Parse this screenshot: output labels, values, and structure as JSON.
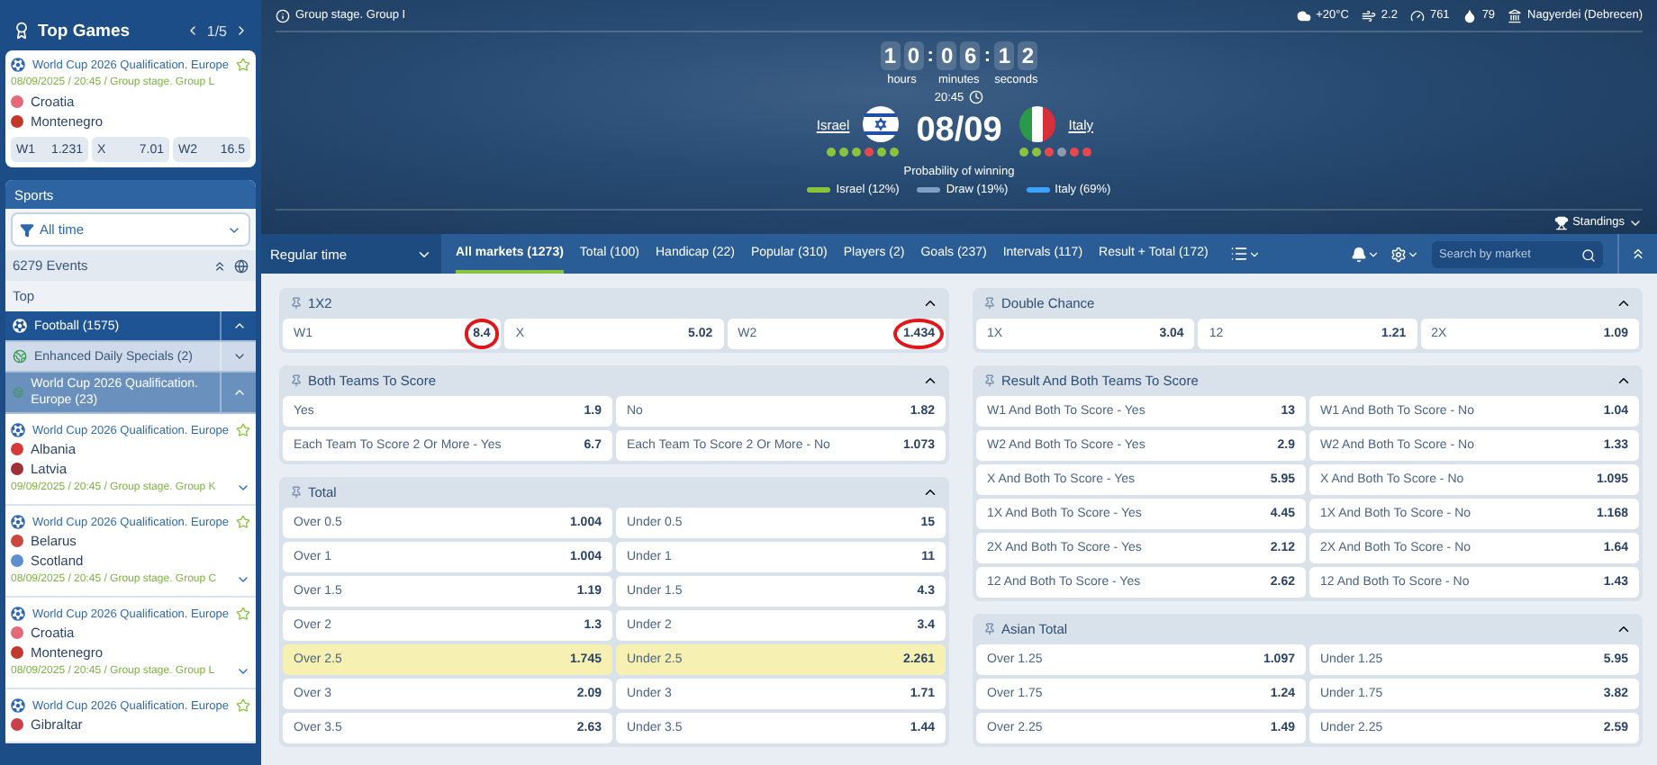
{
  "sidebar": {
    "top_games": {
      "title": "Top Games",
      "pager": "1/5",
      "game": {
        "league": "World Cup 2026 Qualification. Europe",
        "date": "08/09/2025 / 20:45 / Group stage. Group L",
        "teams": [
          {
            "name": "Croatia",
            "color": "#e36a78"
          },
          {
            "name": "Montenegro",
            "color": "#c0392b"
          }
        ],
        "odds": [
          {
            "label": "W1",
            "value": "1.231"
          },
          {
            "label": "X",
            "value": "7.01"
          },
          {
            "label": "W2",
            "value": "16.5"
          }
        ]
      }
    },
    "sports": {
      "title": "Sports",
      "filter": "All time",
      "events": "6279 Events",
      "top": "Top",
      "categories": [
        {
          "name": "Football (1575)",
          "kind": "sport",
          "expanded": true
        },
        {
          "name": "Enhanced Daily Specials (2)",
          "kind": "league",
          "expanded": false
        },
        {
          "name": "World Cup 2026 Qualification. Europe (23)",
          "kind": "league",
          "expanded": true
        }
      ],
      "matches": [
        {
          "league": "World Cup 2026 Qualification. Europe",
          "teams": [
            {
              "name": "Albania",
              "color": "#d33a3a"
            },
            {
              "name": "Latvia",
              "color": "#9e3039"
            }
          ],
          "date": "09/09/2025 / 20:45 / Group stage. Group K"
        },
        {
          "league": "World Cup 2026 Qualification. Europe",
          "teams": [
            {
              "name": "Belarus",
              "color": "#c9473f"
            },
            {
              "name": "Scotland",
              "color": "#5b8fd0"
            }
          ],
          "date": "08/09/2025 / 20:45 / Group stage. Group C"
        },
        {
          "league": "World Cup 2026 Qualification. Europe",
          "teams": [
            {
              "name": "Croatia",
              "color": "#e36a78"
            },
            {
              "name": "Montenegro",
              "color": "#c0392b"
            }
          ],
          "date": "08/09/2025 / 20:45 / Group stage. Group L"
        },
        {
          "league": "World Cup 2026 Qualification. Europe",
          "teams": [
            {
              "name": "Gibraltar",
              "color": "#c8414b"
            }
          ]
        }
      ]
    }
  },
  "match": {
    "stage": "Group stage. Group I",
    "weather": [
      {
        "kind": "temperature",
        "text": "+20°C"
      },
      {
        "kind": "wind",
        "text": "2.2"
      },
      {
        "kind": "pressure",
        "text": "761"
      },
      {
        "kind": "humidity",
        "text": "79"
      },
      {
        "kind": "stadium",
        "text": "Nagyerdei (Debrecen)"
      }
    ],
    "countdown": [
      {
        "digits": [
          "1",
          "0"
        ],
        "unit": "hours",
        "separator": ":"
      },
      {
        "digits": [
          "0",
          "6"
        ],
        "unit": "minutes",
        "separator": ":"
      },
      {
        "digits": [
          "1",
          "2"
        ],
        "unit": "seconds"
      }
    ],
    "time": "20:45",
    "date": "08/09",
    "home": {
      "name": "Israel",
      "form": [
        {
          "color": "#8ac43f"
        },
        {
          "color": "#8ac43f"
        },
        {
          "color": "#8ac43f"
        },
        {
          "color": "#e8474b"
        },
        {
          "color": "#8ac43f"
        },
        {
          "color": "#8ac43f"
        }
      ]
    },
    "away": {
      "name": "Italy",
      "form": [
        {
          "color": "#8ac43f"
        },
        {
          "color": "#8ac43f"
        },
        {
          "color": "#e8474b"
        },
        {
          "color": "#8e9aab"
        },
        {
          "color": "#e8474b"
        },
        {
          "color": "#e8474b"
        }
      ]
    },
    "probability": {
      "title": "Probability of winning",
      "items": [
        {
          "text": "Israel (12%)",
          "color": "#8ac43f"
        },
        {
          "text": "Draw (19%)",
          "color": "#7f9fc4"
        },
        {
          "text": "Italy (69%)",
          "color": "#3ea2ff"
        }
      ]
    },
    "standings": "Standings"
  },
  "markets_bar": {
    "period": "Regular time",
    "tabs": [
      {
        "label": "All markets (1273)",
        "selected": true
      },
      {
        "label": "Total (100)",
        "selected": false
      },
      {
        "label": "Handicap (22)",
        "selected": false
      },
      {
        "label": "Popular (310)",
        "selected": false
      },
      {
        "label": "Players (2)",
        "selected": false
      },
      {
        "label": "Goals (237)",
        "selected": false
      },
      {
        "label": "Intervals (117)",
        "selected": false
      },
      {
        "label": "Result + Total (172)",
        "selected": false
      }
    ],
    "search": {
      "placeholder": "Search by market"
    }
  },
  "markets": [
    [
      {
        "title": "1X2",
        "kind": "three-way",
        "expanded": true,
        "outcomes": [
          {
            "label": "W1",
            "odds": "8.4",
            "highlighted": false,
            "circled": true
          },
          {
            "label": "X",
            "odds": "5.02",
            "highlighted": false,
            "circled": false
          },
          {
            "label": "W2",
            "odds": "1.434",
            "highlighted": false,
            "circled": true
          }
        ]
      },
      {
        "title": "Both Teams To Score",
        "kind": "two-way",
        "expanded": true,
        "outcomes": [
          {
            "label": "Yes",
            "odds": "1.9",
            "highlighted": false
          },
          {
            "label": "No",
            "odds": "1.82",
            "highlighted": false
          },
          {
            "label": "Each Team To Score 2 Or More - Yes",
            "odds": "6.7",
            "highlighted": false
          },
          {
            "label": "Each Team To Score 2 Or More - No",
            "odds": "1.073",
            "highlighted": false
          }
        ]
      },
      {
        "title": "Total",
        "kind": "two-way",
        "expanded": true,
        "outcomes": [
          {
            "label": "Over 0.5",
            "odds": "1.004",
            "highlighted": false
          },
          {
            "label": "Under 0.5",
            "odds": "15",
            "highlighted": false
          },
          {
            "label": "Over 1",
            "odds": "1.004",
            "highlighted": false
          },
          {
            "label": "Under 1",
            "odds": "11",
            "highlighted": false
          },
          {
            "label": "Over 1.5",
            "odds": "1.19",
            "highlighted": false
          },
          {
            "label": "Under 1.5",
            "odds": "4.3",
            "highlighted": false
          },
          {
            "label": "Over 2",
            "odds": "1.3",
            "highlighted": false
          },
          {
            "label": "Under 2",
            "odds": "3.4",
            "highlighted": false
          },
          {
            "label": "Over 2.5",
            "odds": "1.745",
            "highlighted": true
          },
          {
            "label": "Under 2.5",
            "odds": "2.261",
            "highlighted": true
          },
          {
            "label": "Over 3",
            "odds": "2.09",
            "highlighted": false
          },
          {
            "label": "Under 3",
            "odds": "1.71",
            "highlighted": false
          },
          {
            "label": "Over 3.5",
            "odds": "2.63",
            "highlighted": false
          },
          {
            "label": "Under 3.5",
            "odds": "1.44",
            "highlighted": false
          }
        ]
      }
    ],
    [
      {
        "title": "Double Chance",
        "kind": "three-way",
        "expanded": true,
        "outcomes": [
          {
            "label": "1X",
            "odds": "3.04",
            "highlighted": false
          },
          {
            "label": "12",
            "odds": "1.21",
            "highlighted": false
          },
          {
            "label": "2X",
            "odds": "1.09",
            "highlighted": false
          }
        ]
      },
      {
        "title": "Result And Both Teams To Score",
        "kind": "two-way",
        "expanded": true,
        "outcomes": [
          {
            "label": "W1 And Both To Score - Yes",
            "odds": "13",
            "highlighted": false
          },
          {
            "label": "W1 And Both To Score - No",
            "odds": "1.04",
            "highlighted": false
          },
          {
            "label": "W2 And Both To Score - Yes",
            "odds": "2.9",
            "highlighted": false
          },
          {
            "label": "W2 And Both To Score - No",
            "odds": "1.33",
            "highlighted": false
          },
          {
            "label": "X And Both To Score - Yes",
            "odds": "5.95",
            "highlighted": false
          },
          {
            "label": "X And Both To Score - No",
            "odds": "1.095",
            "highlighted": false
          },
          {
            "label": "1X And Both To Score - Yes",
            "odds": "4.45",
            "highlighted": false
          },
          {
            "label": "1X And Both To Score - No",
            "odds": "1.168",
            "highlighted": false
          },
          {
            "label": "2X And Both To Score - Yes",
            "odds": "2.12",
            "highlighted": false
          },
          {
            "label": "2X And Both To Score - No",
            "odds": "1.64",
            "highlighted": false
          },
          {
            "label": "12 And Both To Score - Yes",
            "odds": "2.62",
            "highlighted": false
          },
          {
            "label": "12 And Both To Score - No",
            "odds": "1.43",
            "highlighted": false
          }
        ]
      },
      {
        "title": "Asian Total",
        "kind": "two-way",
        "expanded": true,
        "outcomes": [
          {
            "label": "Over 1.25",
            "odds": "1.097",
            "highlighted": false
          },
          {
            "label": "Under 1.25",
            "odds": "5.95",
            "highlighted": false
          },
          {
            "label": "Over 1.75",
            "odds": "1.24",
            "highlighted": false
          },
          {
            "label": "Under 1.75",
            "odds": "3.82",
            "highlighted": false
          },
          {
            "label": "Over 2.25",
            "odds": "1.49",
            "highlighted": false
          },
          {
            "label": "Under 2.25",
            "odds": "2.59",
            "highlighted": false
          }
        ]
      }
    ]
  ]
}
